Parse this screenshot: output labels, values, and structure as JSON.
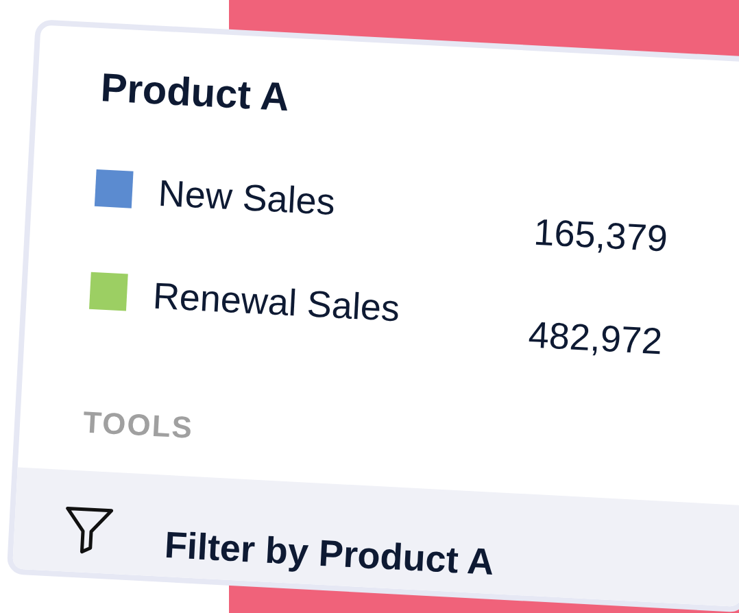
{
  "card": {
    "title": "Product A",
    "legend": [
      {
        "label": "New Sales",
        "value": "165,379",
        "color": "#5b8bd0"
      },
      {
        "label": "Renewal Sales",
        "value": "482,972",
        "color": "#9ccf63"
      }
    ],
    "tools_heading": "TOOLS",
    "tools": [
      {
        "label": "Filter by Product A"
      }
    ]
  }
}
